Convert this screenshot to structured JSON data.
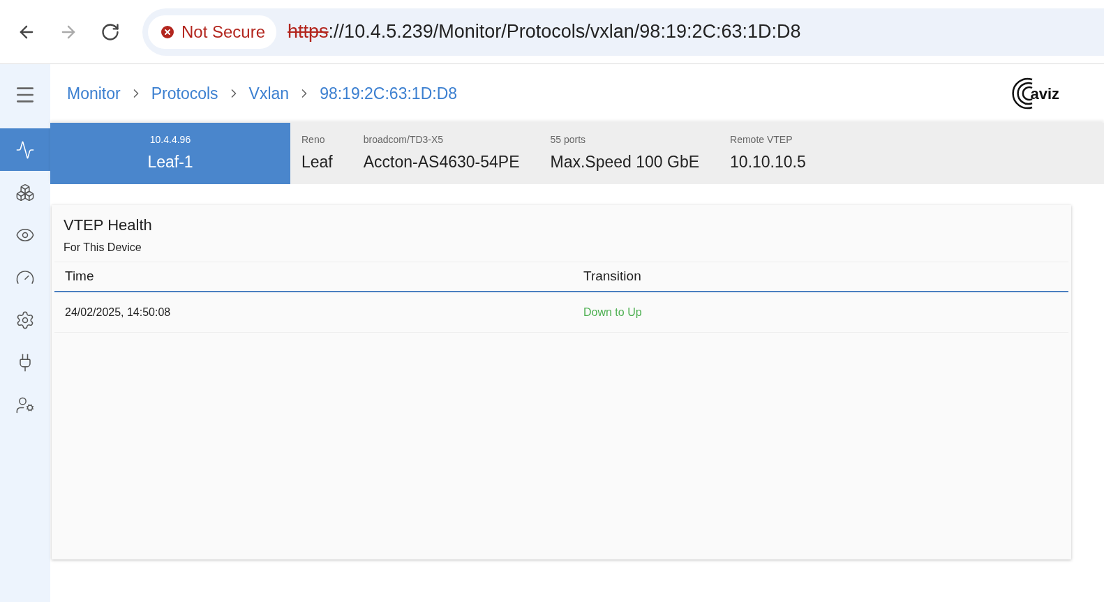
{
  "browser": {
    "security_label": "Not Secure",
    "url_scheme": "https",
    "url_rest": "://10.4.5.239/Monitor/Protocols/vxlan/98:19:2C:63:1D:D8"
  },
  "sidebar": {
    "items": [
      {
        "selected": true
      },
      {
        "selected": false
      },
      {
        "selected": false
      },
      {
        "selected": false
      },
      {
        "selected": false
      },
      {
        "selected": false
      },
      {
        "selected": false
      }
    ]
  },
  "breadcrumbs": [
    "Monitor",
    "Protocols",
    "Vxlan",
    "98:19:2C:63:1D:D8"
  ],
  "logo": {
    "text": "aviz"
  },
  "device": {
    "ip": "10.4.4.96",
    "name": "Leaf-1",
    "fields": [
      {
        "label": "Reno",
        "value": "Leaf"
      },
      {
        "label": "broadcom/TD3-X5",
        "value": "Accton-AS4630-54PE"
      },
      {
        "label": "55 ports",
        "value": "Max.Speed 100 GbE"
      },
      {
        "label": "Remote VTEP",
        "value": "10.10.10.5"
      }
    ]
  },
  "card": {
    "title": "VTEP Health",
    "subtitle": "For This Device",
    "columns": [
      "Time",
      "Transition"
    ],
    "rows": [
      {
        "time": "24/02/2025, 14:50:08",
        "transition": "Down to Up",
        "color": "#4caf50"
      }
    ]
  }
}
